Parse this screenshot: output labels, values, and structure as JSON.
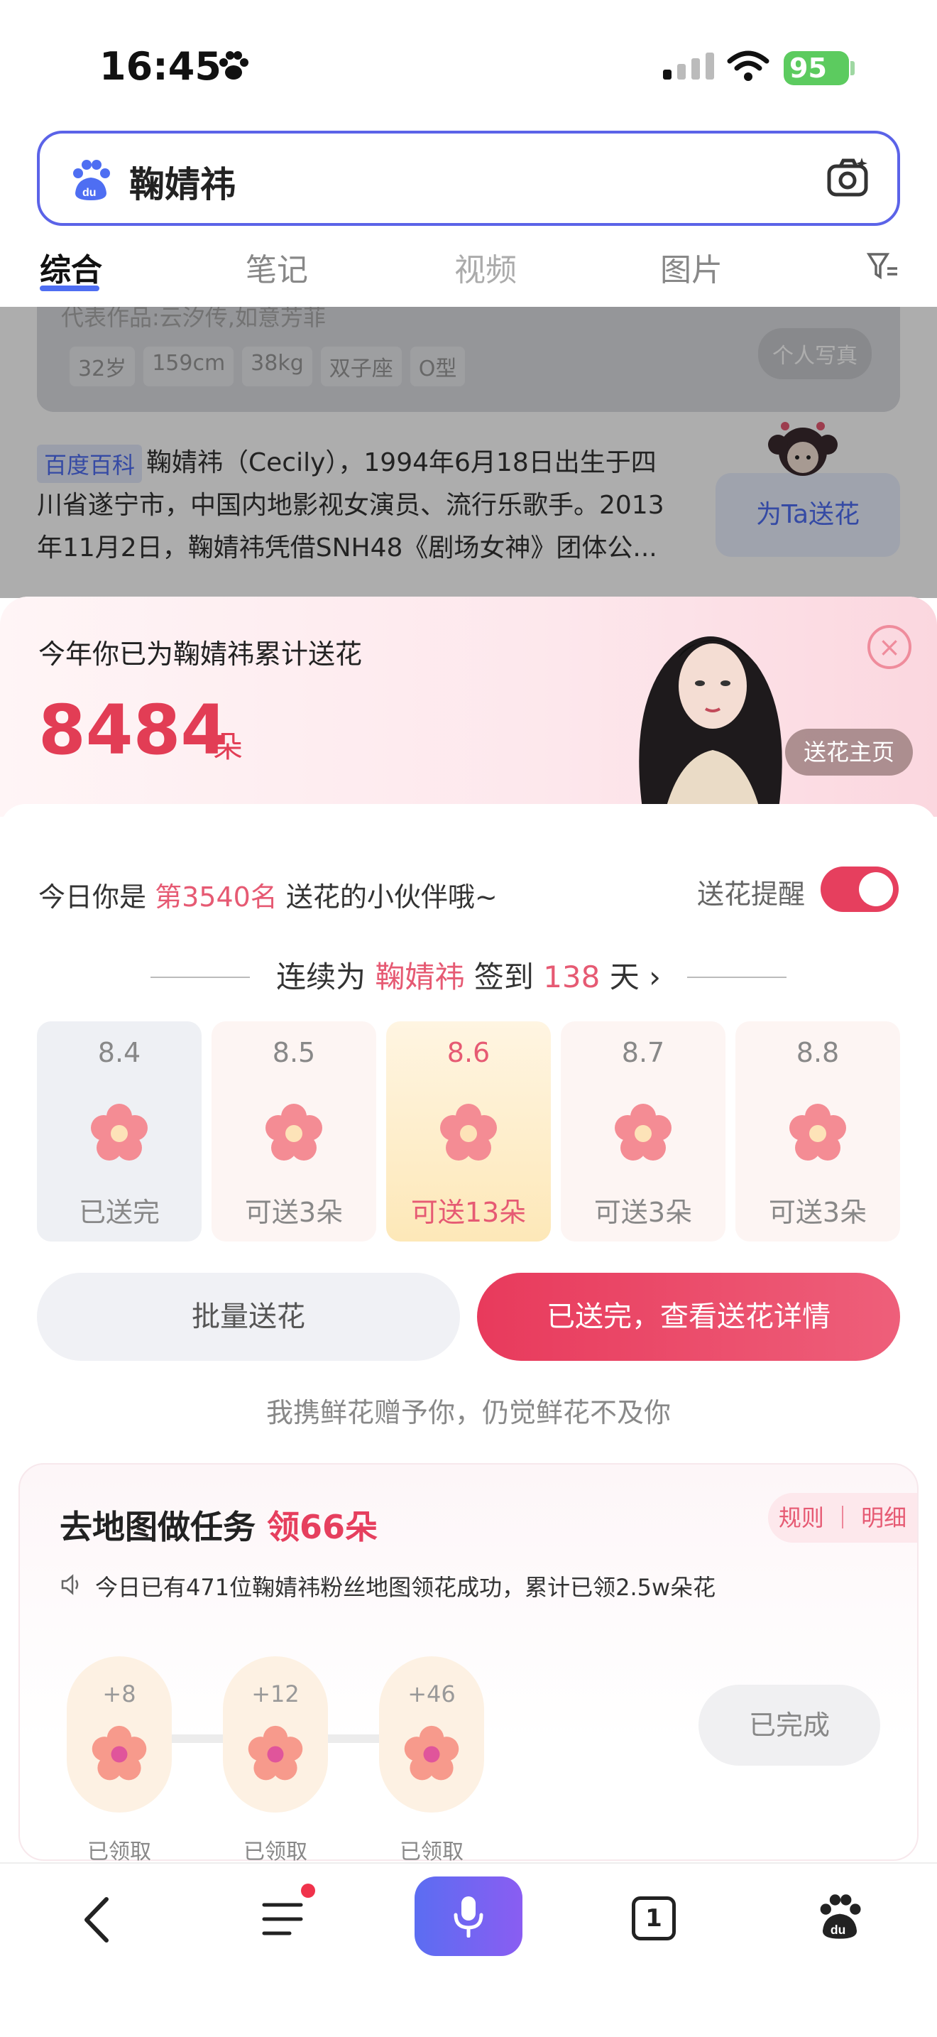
{
  "status_bar": {
    "time": "16:45",
    "battery": "95"
  },
  "search": {
    "query": "鞠婧祎"
  },
  "tabs": [
    "综合",
    "笔记",
    "视频",
    "图片"
  ],
  "background_card": {
    "faded_text": "代表作品:云汐传,如意芳菲",
    "tags": [
      "32岁",
      "159cm",
      "38kg",
      "双子座",
      "O型"
    ],
    "photo_button": "个人写真",
    "baike_tag": "百度百科",
    "baike_text": "鞠婧祎（Cecily），1994年6月18日出生于四川省遂宁市，中国内地影视女演员、流行乐歌手。2013年11月2日，鞠婧祎凭借SNH48《剧场女神》团体公...",
    "gift_button": "为Ta送花"
  },
  "sheet": {
    "title": "今年你已为鞠婧祎累计送花",
    "count": "8484",
    "count_unit": "朵",
    "home_button": "送花主页",
    "close_icon": "×",
    "rank_prefix": "今日你是 ",
    "rank_value": "第3540名",
    "rank_suffix": " 送花的小伙伴哦~",
    "remind_label": "送花提醒",
    "streak_prefix": "连续为 ",
    "streak_name": "鞠婧祎",
    "streak_mid": " 签到 ",
    "streak_days": "138",
    "streak_suffix": " 天 ›",
    "days": [
      {
        "date": "8.4",
        "label": "已送完",
        "state": "done"
      },
      {
        "date": "8.5",
        "label": "可送3朵",
        "state": "available"
      },
      {
        "date": "8.6",
        "label": "可送13朵",
        "state": "today"
      },
      {
        "date": "8.7",
        "label": "可送3朵",
        "state": "available"
      },
      {
        "date": "8.8",
        "label": "可送3朵",
        "state": "available"
      }
    ],
    "batch_button": "批量送花",
    "detail_button": "已送完，查看送花详情",
    "slogan": "我携鲜花赠予你，仍觉鲜花不及你"
  },
  "task": {
    "title": "去地图做任务 ",
    "title_highlight": "领66朵",
    "rules": "规则 ｜ 明细",
    "notice": "今日已有471位鞠婧祎粉丝地图领花成功，累计已领2.5w朵花",
    "rewards": [
      {
        "amount": "+8",
        "label": "已领取"
      },
      {
        "amount": "+12",
        "label": "已领取"
      },
      {
        "amount": "+46",
        "label": "已领取"
      }
    ],
    "done_button": "已完成"
  },
  "nav": {
    "tab_count": "1"
  },
  "colors": {
    "accent": "#e63f5e",
    "brand_blue": "#4e6ef2"
  }
}
